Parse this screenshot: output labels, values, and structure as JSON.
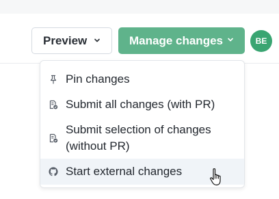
{
  "header": {
    "preview_label": "Preview",
    "manage_label": "Manage changes",
    "avatar_initials": "BE"
  },
  "menu": {
    "items": [
      {
        "label": "Pin changes",
        "icon": "pin-icon"
      },
      {
        "label": "Submit all changes (with PR)",
        "icon": "document-badge-icon"
      },
      {
        "label_line1": "Submit selection of changes",
        "label_line2": "(without PR)",
        "icon": "document-badge-icon"
      },
      {
        "label": "Start external changes",
        "icon": "github-icon",
        "hovered": true
      }
    ]
  },
  "colors": {
    "accent": "#5fb38b",
    "avatar": "#3aa572",
    "hover_row": "#f0f4f8"
  }
}
